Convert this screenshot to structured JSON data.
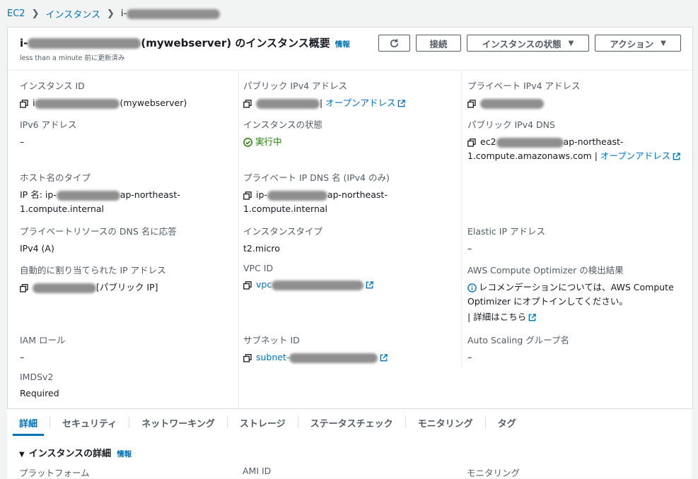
{
  "breadcrumb": {
    "root": "EC2",
    "instances": "インスタンス",
    "current": "i-"
  },
  "header": {
    "title_prefix": "i-",
    "title_suffix": "(mywebserver) のインスタンス概要",
    "info": "情報",
    "updated_time": "less than a minute",
    "updated_label": " 前に更新済み",
    "connect": "接続",
    "instance_state": "インスタンスの状態",
    "actions": "アクション"
  },
  "fields": {
    "instance_id": {
      "label": "インスタンス ID",
      "prefix": "i",
      "suffix": "(mywebserver)"
    },
    "public_ipv4": {
      "label": "パブリック IPv4 アドレス",
      "link": "オープンアドレス"
    },
    "private_ipv4": {
      "label": "プライベート IPv4 アドレス"
    },
    "ipv6": {
      "label": "IPv6 アドレス",
      "value": "–"
    },
    "instance_state": {
      "label": "インスタンスの状態",
      "value": "実行中"
    },
    "public_dns": {
      "label": "パブリック IPv4 DNS",
      "prefix": "ec2",
      "mid": "ap-northeast-",
      "line2": "1.compute.amazonaws.com",
      "sep": " | ",
      "link": "オープンアドレス"
    },
    "hostname_type": {
      "label": "ホスト名のタイプ",
      "prefix": "IP 名: ip-",
      "mid": "ap-northeast-",
      "line2": "1.compute.internal"
    },
    "private_dns": {
      "label": "プライベート IP DNS 名 (IPv4 のみ)",
      "prefix": "ip-",
      "mid": "ap-northeast-",
      "line2": "1.compute.internal"
    },
    "private_resource_dns": {
      "label": "プライベートリソースの DNS 名に応答",
      "value": "IPv4 (A)"
    },
    "instance_type": {
      "label": "インスタンスタイプ",
      "value": "t2.micro"
    },
    "elastic_ip": {
      "label": "Elastic IP アドレス",
      "value": "–"
    },
    "auto_assigned_ip": {
      "label": "自動的に割り当てられた IP アドレス",
      "suffix": "[パブリック IP]"
    },
    "vpc_id": {
      "label": "VPC ID",
      "prefix": "vpc"
    },
    "compute_optimizer": {
      "label": "AWS Compute Optimizer の検出結果",
      "line1": "レコメンデーションについては、AWS Compute",
      "line2": "Optimizer にオプトインしてください。",
      "link": "詳細はこちら"
    },
    "iam_role": {
      "label": "IAM ロール",
      "value": "–"
    },
    "subnet_id": {
      "label": "サブネット ID",
      "prefix": "subnet-"
    },
    "auto_scaling": {
      "label": "Auto Scaling グループ名",
      "value": "–"
    },
    "imdsv2": {
      "label": "IMDSv2",
      "value": "Required"
    }
  },
  "tabs": [
    "詳細",
    "セキュリティ",
    "ネットワーキング",
    "ストレージ",
    "ステータスチェック",
    "モニタリング",
    "タグ"
  ],
  "details_section": {
    "title": "インスタンスの詳細",
    "info": "情報",
    "cut_labels": [
      "プラットフォーム",
      "AMI ID",
      "モニタリング"
    ]
  },
  "colors": {
    "link": "#0073bb",
    "success": "#1d8102",
    "border": "#d5dbdb",
    "text": "#16191f",
    "muted": "#545b64"
  }
}
